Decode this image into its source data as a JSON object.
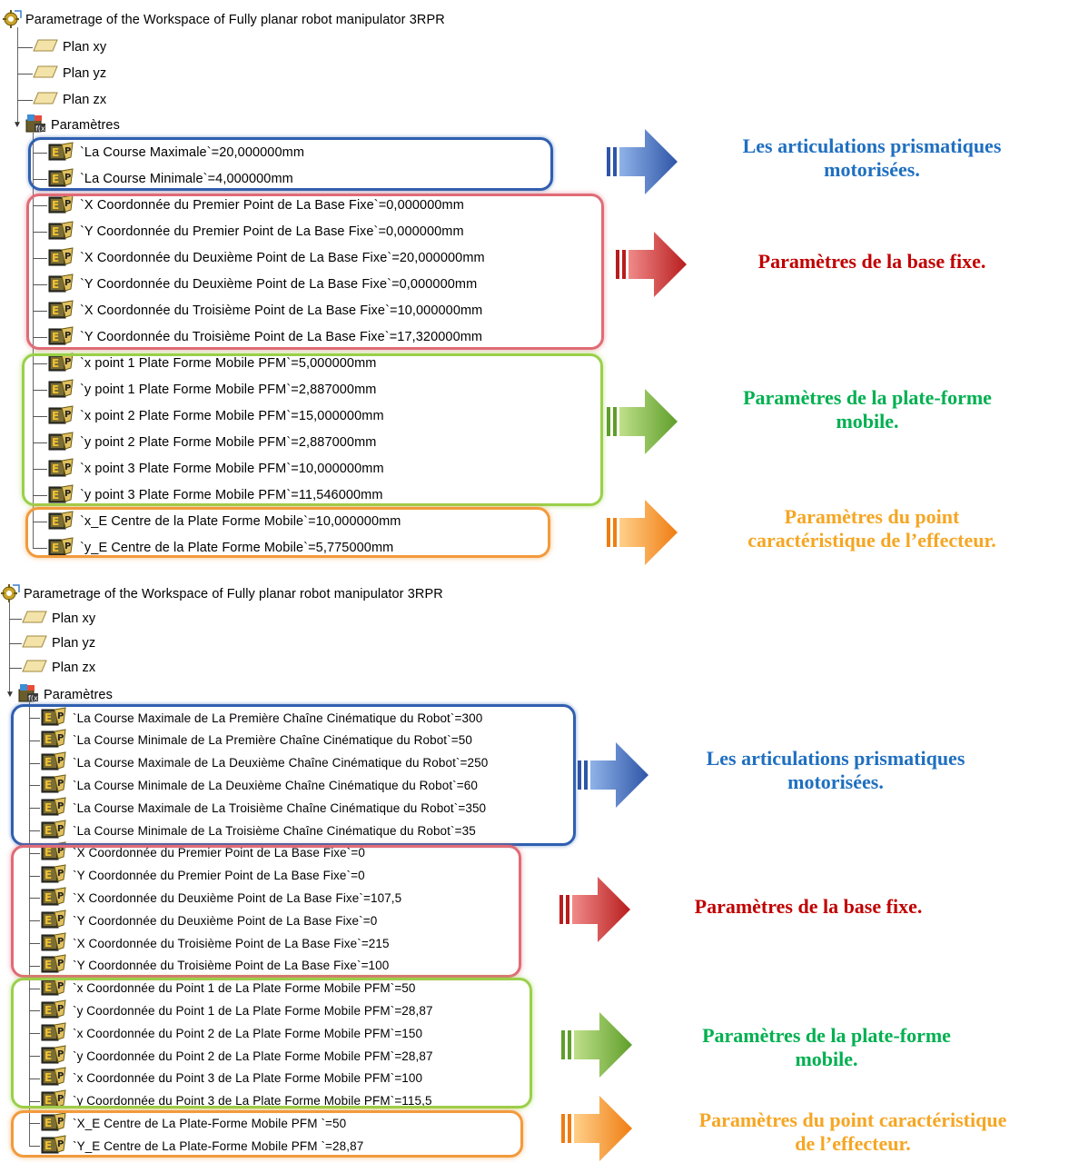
{
  "colors": {
    "blue": "#1f6fc0",
    "red": "#c00000",
    "green": "#00b050",
    "orange": "#f5a623"
  },
  "top": {
    "root": "Parametrage of the Workspace of Fully planar robot manipulator 3RPR",
    "planes": [
      "Plan xy",
      "Plan yz",
      "Plan zx"
    ],
    "params_label": "Paramètres",
    "params": [
      "`La Course Maximale`=20,000000mm",
      "`La Course Minimale`=4,000000mm",
      "`X Coordonnée du Premier Point de La Base Fixe`=0,000000mm",
      "`Y Coordonnée du Premier Point de La Base Fixe`=0,000000mm",
      "`X Coordonnée du Deuxième Point de La Base Fixe`=20,000000mm",
      "`Y Coordonnée du Deuxième Point de La Base Fixe`=0,000000mm",
      "`X Coordonnée du Troisième Point de La Base Fixe`=10,000000mm",
      "`Y Coordonnée du Troisième Point de La Base Fixe`=17,320000mm",
      "`x point 1  Plate Forme Mobile PFM`=5,000000mm",
      "`y point 1  Plate Forme Mobile PFM`=2,887000mm",
      "`x point 2  Plate Forme Mobile PFM`=15,000000mm",
      "`y point 2  Plate Forme Mobile PFM`=2,887000mm",
      "`x point 3  Plate Forme Mobile PFM`=10,000000mm",
      "`y point 3  Plate Forme Mobile PFM`=11,546000mm",
      "`x_E Centre de la Plate Forme Mobile`=10,000000mm",
      "`y_E Centre de la Plate Forme Mobile`=5,775000mm"
    ],
    "labels": {
      "blue": [
        "Les articulations  prismatiques",
        "motorisées."
      ],
      "red": [
        "Paramètres de la base fixe."
      ],
      "green": [
        "Paramètres de la plate-forme",
        "mobile."
      ],
      "orange": [
        "Paramètres du point",
        "caractéristique de l’effecteur."
      ]
    }
  },
  "bottom": {
    "root": "Parametrage of the Workspace of Fully planar robot manipulator 3RPR",
    "planes": [
      "Plan xy",
      "Plan yz",
      "Plan zx"
    ],
    "params_label": "Paramètres",
    "params": [
      "`La Course Maximale de La Première Chaîne Cinématique du Robot`=300",
      "`La Course Minimale de La Première Chaîne Cinématique du Robot`=50",
      "`La Course Maximale de La Deuxième Chaîne Cinématique du Robot`=250",
      "`La Course Minimale de La Deuxième Chaîne Cinématique du Robot`=60",
      "`La Course Maximale de La Troisième Chaîne Cinématique du Robot`=350",
      "`La Course Minimale de La Troisième Chaîne Cinématique du Robot`=35",
      "`X Coordonnée du Premier Point de La Base Fixe`=0",
      "`Y Coordonnée du Premier Point de La Base Fixe`=0",
      "`X Coordonnée du Deuxième Point de La Base Fixe`=107,5",
      "`Y Coordonnée du Deuxième Point de La Base Fixe`=0",
      "`X Coordonnée du Troisième Point de La Base Fixe`=215",
      "`Y Coordonnée du Troisième Point de La Base Fixe`=100",
      "`x Coordonnée du Point 1 de La Plate Forme Mobile PFM`=50",
      "`y Coordonnée du Point 1 de La Plate Forme Mobile PFM`=28,87",
      "`x Coordonnée du Point 2 de La Plate Forme Mobile PFM`=150",
      "`y Coordonnée du Point 2 de La Plate Forme Mobile PFM`=28,87",
      "`x Coordonnée du Point 3 de La Plate Forme Mobile PFM`=100",
      "`y Coordonnée du Point 3 de La Plate Forme Mobile PFM`=115,5",
      "`X_E Centre de La Plate-Forme Mobile PFM `=50",
      "`Y_E Centre de La Plate-Forme Mobile PFM `=28,87"
    ],
    "labels": {
      "blue": [
        "Les articulations  prismatiques",
        "motorisées."
      ],
      "red": [
        "Paramètres de la base fixe."
      ],
      "green": [
        "Paramètres de la plate-forme",
        "mobile."
      ],
      "orange": [
        "Paramètres du point caractéristique",
        "de l’effecteur."
      ]
    }
  }
}
